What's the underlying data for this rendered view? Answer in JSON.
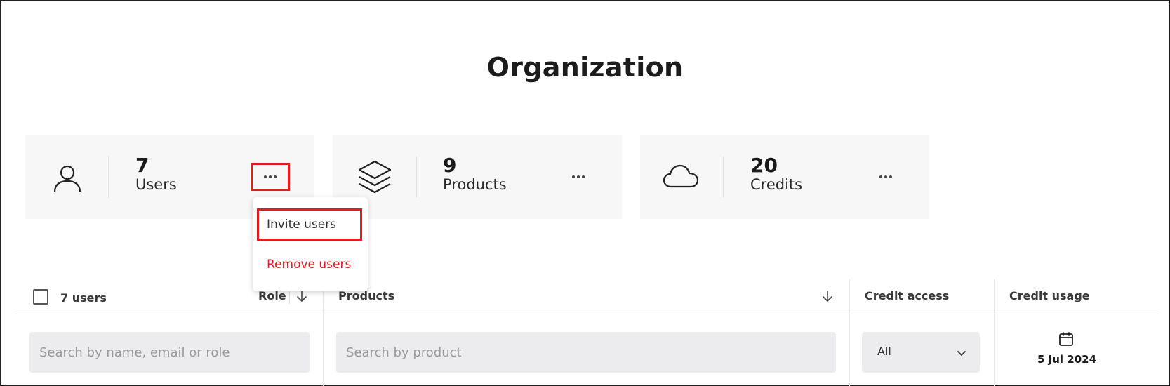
{
  "page": {
    "title": "Organization"
  },
  "cards": [
    {
      "count": "7",
      "label": "Users",
      "icon": "user-icon"
    },
    {
      "count": "9",
      "label": "Products",
      "icon": "layers-icon"
    },
    {
      "count": "20",
      "label": "Credits",
      "icon": "cloud-icon"
    }
  ],
  "menu": {
    "invite": "Invite users",
    "remove": "Remove users"
  },
  "table": {
    "users_count": "7 users",
    "role": "Role",
    "products": "Products",
    "credit_access": "Credit access",
    "credit_usage": "Credit usage"
  },
  "filters": {
    "name_placeholder": "Search by name, email or role",
    "product_placeholder": "Search by product",
    "credit_access_value": "All",
    "credit_usage_date": "5 Jul 2024"
  },
  "colors": {
    "highlight": "#e31b23",
    "card_bg": "#f7f7f7",
    "input_bg": "#ececee",
    "danger": "#e31b23"
  }
}
